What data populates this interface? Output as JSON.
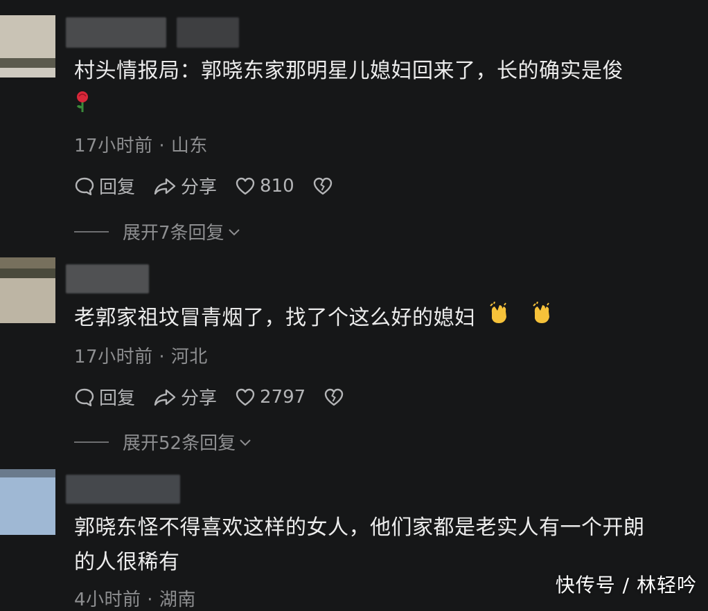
{
  "comments": [
    {
      "text": "村头情报局：郭晓东家那明星儿媳妇回来了，长的确实是俊",
      "emoji": "rose-emoji",
      "meta": "17小时前 · 山东",
      "reply_label": "回复",
      "share_label": "分享",
      "likes": "810",
      "expand_label": "展开7条回复"
    },
    {
      "text": "老郭家祖坟冒青烟了，找了个这么好的媳妇",
      "emoji": "clapping-hands-emoji",
      "meta": "17小时前 · 河北",
      "reply_label": "回复",
      "share_label": "分享",
      "likes": "2797",
      "expand_label": "展开52条回复"
    },
    {
      "text_line1": "郭晓东怪不得喜欢这样的女人，他们家都是老实人有一个开朗",
      "text_line2": "的人很稀有",
      "meta": "4小时前 · 湖南"
    }
  ],
  "watermark": "快传号 / 林轻吟",
  "colors": {
    "background": "#161718",
    "text": "#ececec",
    "meta": "#8e8f91",
    "action": "#b4b5b7"
  }
}
